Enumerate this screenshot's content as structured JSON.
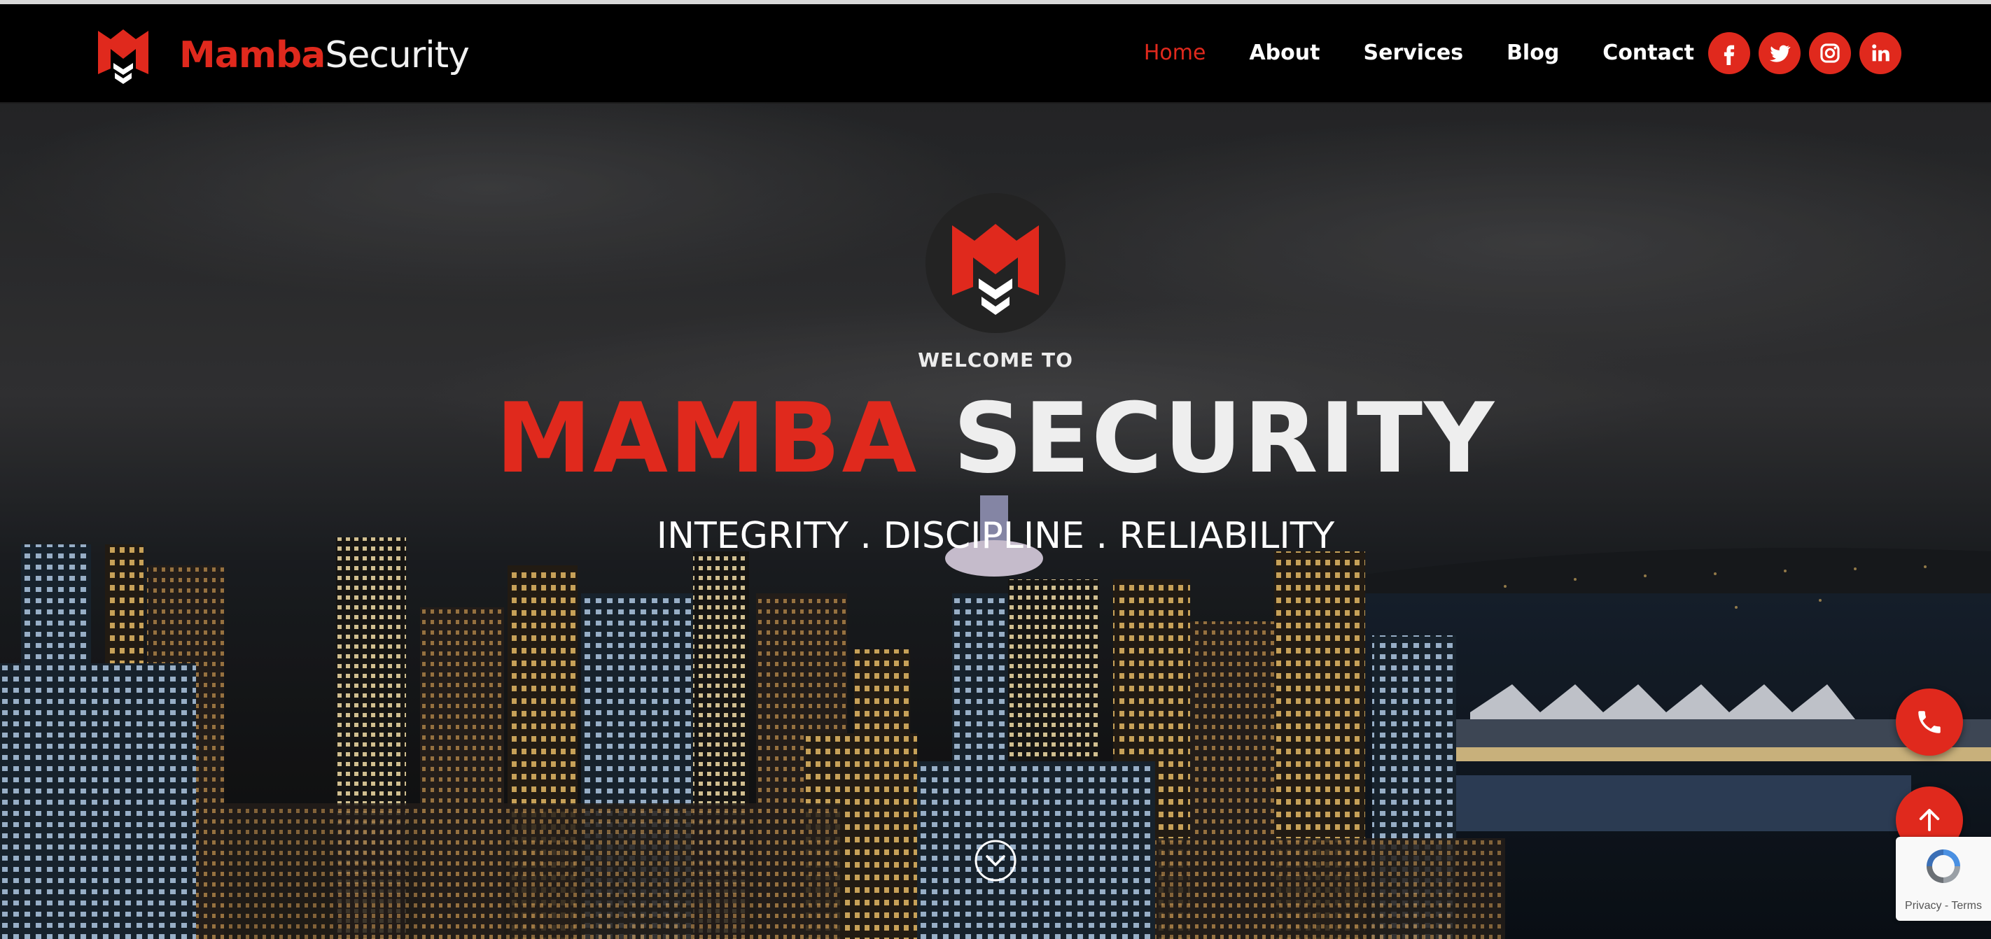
{
  "brand": {
    "name_part1": "Mamba",
    "name_part2": "Security",
    "logo_icon": "mamba-m-chevron-logo"
  },
  "nav": {
    "items": [
      {
        "label": "Home",
        "active": true
      },
      {
        "label": "About"
      },
      {
        "label": "Services"
      },
      {
        "label": "Blog"
      },
      {
        "label": "Contact"
      }
    ]
  },
  "socials": [
    {
      "icon": "facebook-icon"
    },
    {
      "icon": "twitter-icon"
    },
    {
      "icon": "instagram-icon"
    },
    {
      "icon": "linkedin-icon"
    }
  ],
  "hero": {
    "welcome": "WELCOME TO",
    "title_part1": "MAMBA",
    "title_part2": "SECURITY",
    "tagline": "INTEGRITY . DISCIPLINE . RELIABILITY",
    "background": "night city skyline",
    "scroll_icon": "chevron-down-circle-icon"
  },
  "floating": {
    "phone_icon": "phone-icon",
    "top_icon": "arrow-up-icon"
  },
  "recaptcha": {
    "privacy": "Privacy",
    "separator": " - ",
    "terms": "Terms"
  },
  "colors": {
    "accent": "#e0291d",
    "nav_bg": "#000000",
    "text": "#ffffff"
  }
}
